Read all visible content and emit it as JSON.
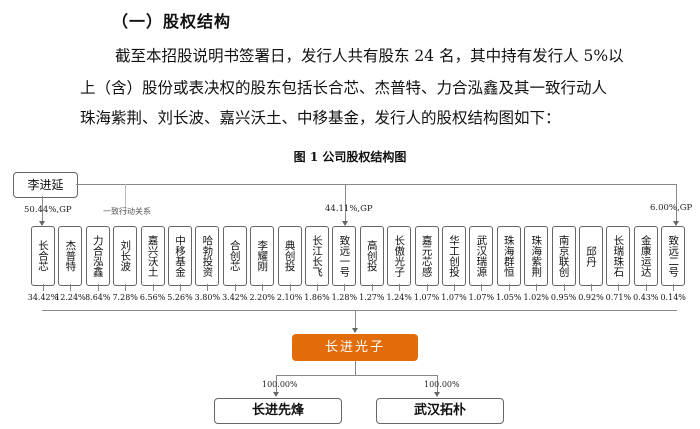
{
  "heading": "（一）股权结构",
  "paragraph_lines": [
    "截至本招股说明书签署日，发行人共有股东 24 名，其中持有发行人 5%以",
    "上（含）股份或表决权的股东包括长合芯、杰普特、力合泓鑫及其一致行动人",
    "珠海紫荆、刘长波、嘉兴沃土、中移基金，发行人的股权结构图如下："
  ],
  "figure_title": "图 1 公司股权结构图",
  "controller": "李进延",
  "labels": {
    "gp1": "50.44%,GP",
    "concert": "一致行动关系",
    "gp2": "44.11%,GP",
    "gp3": "6.00%,GP"
  },
  "shareholders": [
    {
      "name": "长合芯",
      "pct": "34.42%"
    },
    {
      "name": "杰普特",
      "pct": "12.24%"
    },
    {
      "name": "力合泓鑫",
      "pct": "8.64%"
    },
    {
      "name": "刘长波",
      "pct": "7.28%"
    },
    {
      "name": "嘉兴沃土",
      "pct": "6.56%"
    },
    {
      "name": "中移基金",
      "pct": "5.26%"
    },
    {
      "name": "哈勃投资",
      "pct": "3.80%"
    },
    {
      "name": "合创芯",
      "pct": "3.42%"
    },
    {
      "name": "李耀刚",
      "pct": "2.20%"
    },
    {
      "name": "典创投",
      "pct": "2.10%"
    },
    {
      "name": "长江长飞",
      "pct": "1.86%"
    },
    {
      "name": "致远一号",
      "pct": "1.28%"
    },
    {
      "name": "高创投",
      "pct": "1.27%"
    },
    {
      "name": "长傲光子",
      "pct": "1.24%"
    },
    {
      "name": "嘉元芯感",
      "pct": "1.07%"
    },
    {
      "name": "华工创投",
      "pct": "1.07%"
    },
    {
      "name": "武汉瑞源",
      "pct": "1.07%"
    },
    {
      "name": "珠海群恒",
      "pct": "1.05%"
    },
    {
      "name": "珠海紫荆",
      "pct": "1.02%"
    },
    {
      "name": "南京联创",
      "pct": "0.95%"
    },
    {
      "name": "邱丹",
      "pct": "0.92%"
    },
    {
      "name": "长瑞珠石",
      "pct": "0.71%"
    },
    {
      "name": "金康运达",
      "pct": "0.43%"
    },
    {
      "name": "致远二号",
      "pct": "0.14%"
    }
  ],
  "company": "长进光子",
  "subsidiaries": [
    {
      "name": "长进先烽",
      "pct": "100.00%"
    },
    {
      "name": "武汉拓朴",
      "pct": "100.00%"
    }
  ]
}
